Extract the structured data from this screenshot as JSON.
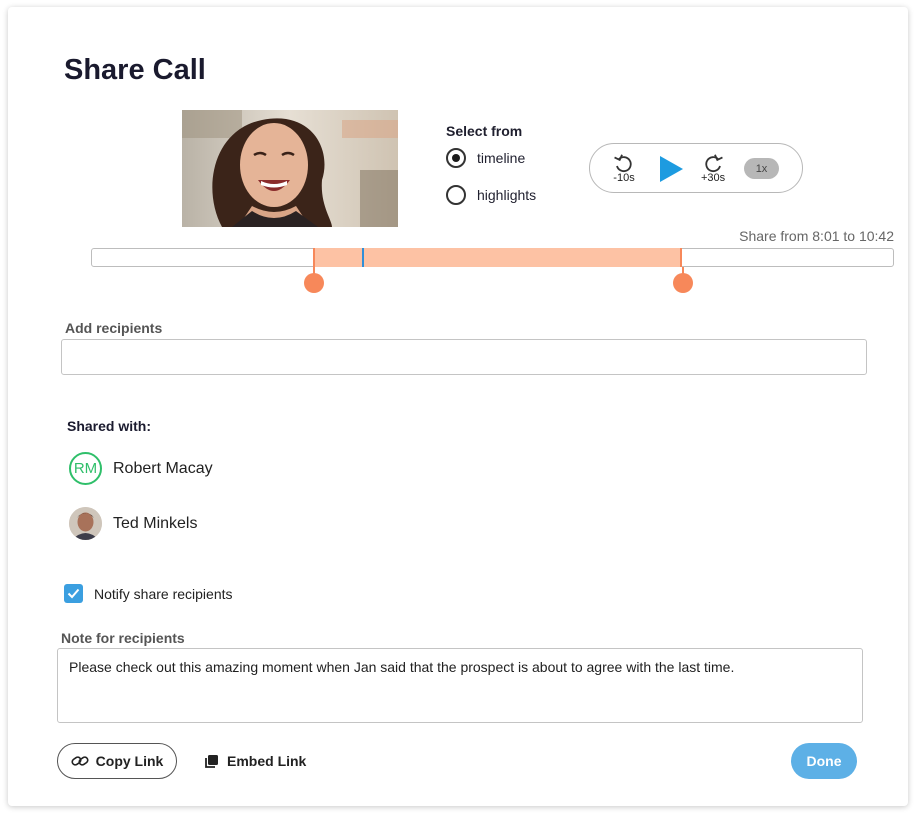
{
  "dialog": {
    "title": "Share Call"
  },
  "video": {
    "thumbnail_icon": "speaker-portrait-thumbnail"
  },
  "select_from": {
    "label": "Select from",
    "options": [
      {
        "label": "timeline",
        "selected": true
      },
      {
        "label": "highlights",
        "selected": false
      }
    ]
  },
  "player": {
    "rewind_label": "-10s",
    "forward_label": "+30s",
    "speed_label": "1x",
    "play_color": "#1d9be0"
  },
  "range": {
    "text": "Share from 8:01 to 10:42"
  },
  "recipients": {
    "label": "Add recipients",
    "value": "",
    "placeholder": ""
  },
  "shared_with": {
    "label": "Shared with:",
    "people": [
      {
        "name": "Robert Macay",
        "initials": "RM",
        "avatar": "initials"
      },
      {
        "name": "Ted Minkels",
        "avatar": "photo"
      }
    ]
  },
  "notify": {
    "label": "Notify share recipients",
    "checked": true
  },
  "note": {
    "label": "Note for recipients",
    "value": "Please check out this amazing moment when Jan said that the prospect is about to agree with the last time."
  },
  "actions": {
    "copy_label": "Copy Link",
    "embed_label": "Embed Link",
    "done_label": "Done"
  },
  "colors": {
    "selection": "#fdc2a4",
    "handle": "#f7885a",
    "accent": "#3b9fe0",
    "avatar_ring": "#2fbf6a"
  }
}
